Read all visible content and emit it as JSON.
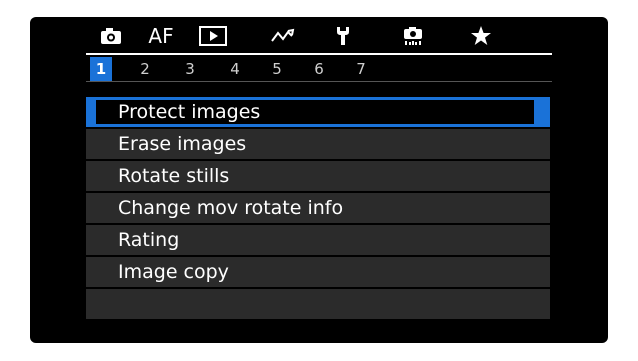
{
  "main_tabs": [
    {
      "id": "shoot",
      "icon": "camera-icon",
      "label": ""
    },
    {
      "id": "af",
      "icon": "",
      "label": "AF"
    },
    {
      "id": "playback",
      "icon": "playback-icon",
      "label": "",
      "active": true
    },
    {
      "id": "wireless",
      "icon": "wireless-icon",
      "label": ""
    },
    {
      "id": "setup",
      "icon": "wrench-icon",
      "label": ""
    },
    {
      "id": "custom",
      "icon": "custom-function-icon",
      "label": ""
    },
    {
      "id": "mymenu",
      "icon": "star-icon",
      "label": ""
    }
  ],
  "sub_tabs": [
    "1",
    "2",
    "3",
    "4",
    "5",
    "6",
    "7"
  ],
  "active_sub_tab": "1",
  "menu": {
    "items": [
      {
        "label": "Protect images",
        "selected": true
      },
      {
        "label": "Erase images"
      },
      {
        "label": "Rotate stills"
      },
      {
        "label": "Change mov rotate info"
      },
      {
        "label": "Rating"
      },
      {
        "label": "Image copy"
      },
      {
        "label": ""
      }
    ]
  },
  "colors": {
    "accent": "#1a72d8",
    "background": "#000000",
    "row": "#2b2b2b",
    "text": "#ffffff"
  }
}
